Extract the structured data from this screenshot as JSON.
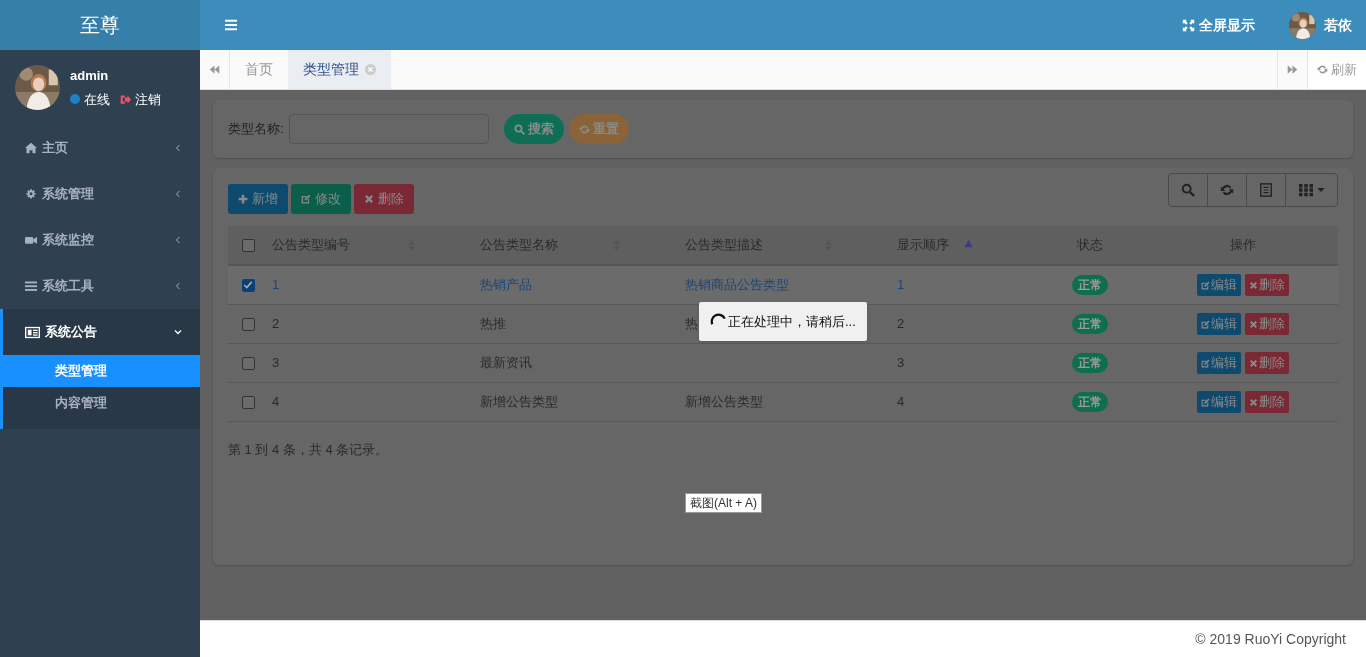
{
  "sidebar": {
    "brand": "至尊",
    "user": {
      "name": "admin",
      "status": "在线",
      "logout": "注销"
    },
    "menu": [
      {
        "label": "主页",
        "expanded": false
      },
      {
        "label": "系统管理",
        "expanded": false
      },
      {
        "label": "系统监控",
        "expanded": false
      },
      {
        "label": "系统工具",
        "expanded": false
      },
      {
        "label": "系统公告",
        "expanded": true,
        "children": [
          {
            "label": "类型管理",
            "selected": true
          },
          {
            "label": "内容管理",
            "selected": false
          }
        ]
      }
    ]
  },
  "header": {
    "fullscreen": "全屏显示",
    "user": "若依"
  },
  "tabs": [
    {
      "label": "首页",
      "selected": false,
      "closable": false
    },
    {
      "label": "类型管理",
      "selected": true,
      "closable": true
    }
  ],
  "refresh": "刷新",
  "search": {
    "label": "类型名称:",
    "buttons": [
      {
        "label": "搜索",
        "kind": "search"
      },
      {
        "label": "重置",
        "kind": "reset"
      }
    ]
  },
  "toolbar": [
    {
      "label": "新增",
      "kind": "add"
    },
    {
      "label": "修改",
      "kind": "edit"
    },
    {
      "label": "删除",
      "kind": "delete"
    }
  ],
  "table": {
    "all_selected": false,
    "columns": [
      {
        "label": "公告类型编号",
        "sorted_ascending": false
      },
      {
        "label": "公告类型名称",
        "sorted_ascending": false
      },
      {
        "label": "公告类型描述",
        "sorted_ascending": false
      },
      {
        "label": "显示顺序",
        "sorted_ascending": true
      },
      {
        "label": "状态"
      },
      {
        "label": "操作"
      }
    ],
    "rows": [
      {
        "selected": true,
        "cells": [
          "1",
          "热销产品",
          "热销商品公告类型",
          "1"
        ],
        "status": "正常",
        "actions": [
          "编辑",
          "删除"
        ]
      },
      {
        "selected": false,
        "cells": [
          "2",
          "热推",
          "热",
          "2"
        ],
        "status": "正常",
        "actions": [
          "编辑",
          "删除"
        ]
      },
      {
        "selected": false,
        "cells": [
          "3",
          "最新资讯",
          null,
          "3"
        ],
        "status": "正常",
        "actions": [
          "编辑",
          "删除"
        ]
      },
      {
        "selected": false,
        "cells": [
          "4",
          "新增公告类型",
          "新增公告类型",
          "4"
        ],
        "status": "正常",
        "actions": [
          "编辑",
          "删除"
        ]
      }
    ]
  },
  "pagination": "第 1 到 4 条，共 4 条记录。",
  "loading": "正在处理中，请稍后...",
  "tooltip": "截图(Alt + A)",
  "footer": "© 2019 RuoYi Copyright"
}
